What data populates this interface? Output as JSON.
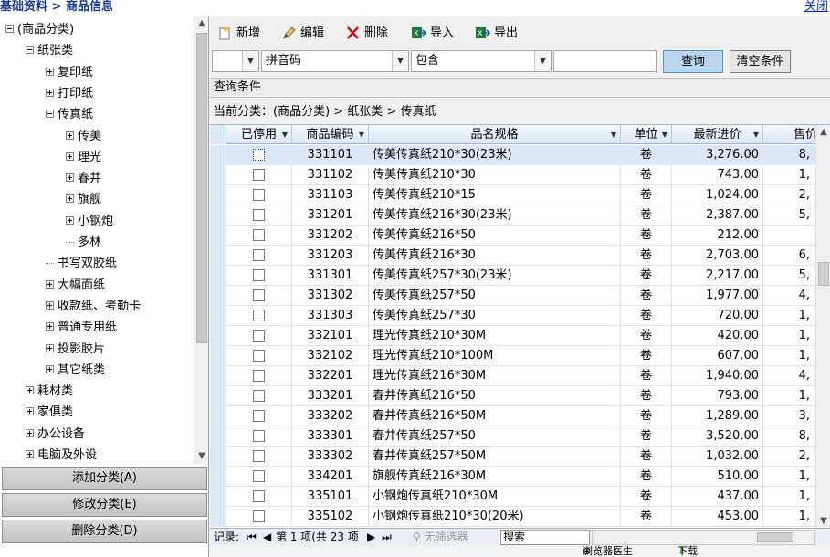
{
  "breadcrumb": "基础资料 > 商品信息",
  "close_link": "关闭",
  "tree": [
    {
      "label": "(商品分类)",
      "level": 0,
      "state": "minus"
    },
    {
      "label": "纸张类",
      "level": 1,
      "state": "minus"
    },
    {
      "label": "复印纸",
      "level": 2,
      "state": "plus"
    },
    {
      "label": "打印纸",
      "level": 2,
      "state": "plus"
    },
    {
      "label": "传真纸",
      "level": 2,
      "state": "minus"
    },
    {
      "label": "传美",
      "level": 3,
      "state": "plus"
    },
    {
      "label": "理光",
      "level": 3,
      "state": "plus"
    },
    {
      "label": "春井",
      "level": 3,
      "state": "plus"
    },
    {
      "label": "旗舰",
      "level": 3,
      "state": "plus"
    },
    {
      "label": "小钢炮",
      "level": 3,
      "state": "plus"
    },
    {
      "label": "多林",
      "level": 3,
      "state": "leaf"
    },
    {
      "label": "书写双胶纸",
      "level": 2,
      "state": "leaf"
    },
    {
      "label": "大幅面纸",
      "level": 2,
      "state": "plus"
    },
    {
      "label": "收款纸、考勤卡",
      "level": 2,
      "state": "plus"
    },
    {
      "label": "普通专用纸",
      "level": 2,
      "state": "plus"
    },
    {
      "label": "投影胶片",
      "level": 2,
      "state": "plus"
    },
    {
      "label": "其它纸类",
      "level": 2,
      "state": "plus"
    },
    {
      "label": "耗材类",
      "level": 1,
      "state": "plus"
    },
    {
      "label": "家俱类",
      "level": 1,
      "state": "plus"
    },
    {
      "label": "办公设备",
      "level": 1,
      "state": "plus"
    },
    {
      "label": "电脑及外设",
      "level": 1,
      "state": "plus"
    }
  ],
  "category_buttons": {
    "add": "添加分类(A)",
    "edit": "修改分类(E)",
    "delete": "删除分类(D)"
  },
  "toolbar": {
    "new": "新增",
    "edit": "编辑",
    "delete": "删除",
    "import": "导入",
    "export": "导出"
  },
  "filter": {
    "field1": "",
    "field2": "拼音码",
    "op": "包含",
    "value": "",
    "query_btn": "查询",
    "clear_btn": "清空条件"
  },
  "condition_label": "查询条件",
  "current_path": "当前分类：(商品分类) > 纸张类 > 传真纸",
  "grid": {
    "headers": {
      "disabled": "已停用",
      "code": "商品编码",
      "name": "品名规格",
      "unit": "单位",
      "last_price": "最新进价",
      "sale_price": "售价"
    },
    "rows": [
      {
        "code": "331101",
        "name": "传美传真纸210*30(23米)",
        "unit": "卷",
        "price": "3,276.00",
        "sale": "8,"
      },
      {
        "code": "331102",
        "name": "传美传真纸210*30",
        "unit": "卷",
        "price": "743.00",
        "sale": "1,"
      },
      {
        "code": "331103",
        "name": "传美传真纸210*15",
        "unit": "卷",
        "price": "1,024.00",
        "sale": "2,"
      },
      {
        "code": "331201",
        "name": "传美传真纸216*30(23米)",
        "unit": "卷",
        "price": "2,387.00",
        "sale": "5,"
      },
      {
        "code": "331202",
        "name": "传美传真纸216*50",
        "unit": "卷",
        "price": "212.00",
        "sale": ""
      },
      {
        "code": "331203",
        "name": "传美传真纸216*30",
        "unit": "卷",
        "price": "2,703.00",
        "sale": "6,"
      },
      {
        "code": "331301",
        "name": "传美传真纸257*30(23米)",
        "unit": "卷",
        "price": "2,217.00",
        "sale": "5,"
      },
      {
        "code": "331302",
        "name": "传美传真纸257*50",
        "unit": "卷",
        "price": "1,977.00",
        "sale": "4,"
      },
      {
        "code": "331303",
        "name": "传美传真纸257*30",
        "unit": "卷",
        "price": "720.00",
        "sale": "1,"
      },
      {
        "code": "332101",
        "name": "理光传真纸210*30M",
        "unit": "卷",
        "price": "420.00",
        "sale": "1,"
      },
      {
        "code": "332102",
        "name": "理光传真纸210*100M",
        "unit": "卷",
        "price": "607.00",
        "sale": "1,"
      },
      {
        "code": "332201",
        "name": "理光传真纸216*30M",
        "unit": "卷",
        "price": "1,940.00",
        "sale": "4,"
      },
      {
        "code": "333201",
        "name": "春井传真纸216*50",
        "unit": "卷",
        "price": "793.00",
        "sale": "1,"
      },
      {
        "code": "333202",
        "name": "春井传真纸216*50M",
        "unit": "卷",
        "price": "1,289.00",
        "sale": "3,"
      },
      {
        "code": "333301",
        "name": "春井传真纸257*50",
        "unit": "卷",
        "price": "3,520.00",
        "sale": "8,"
      },
      {
        "code": "333302",
        "name": "春井传真纸257*50M",
        "unit": "卷",
        "price": "1,032.00",
        "sale": "2,"
      },
      {
        "code": "334201",
        "name": "旗舰传真纸216*30M",
        "unit": "卷",
        "price": "510.00",
        "sale": "1,"
      },
      {
        "code": "335101",
        "name": "小钢炮传真纸210*30M",
        "unit": "卷",
        "price": "437.00",
        "sale": "1,"
      },
      {
        "code": "335102",
        "name": "小钢炮传真纸210*30(20米)",
        "unit": "卷",
        "price": "453.00",
        "sale": "1,"
      }
    ]
  },
  "navbar": {
    "records_label": "记录:",
    "first": "⏮",
    "prev": "◀",
    "position": "第 1 项(共 23 项",
    "next": "▶",
    "last": "⏭",
    "no_filter": "无筛选器",
    "search": "搜索"
  },
  "statusbar": {
    "doctor": "浏览器医生",
    "download": "下载"
  },
  "colors": {
    "accent": "#1a3a8f",
    "selected_row": "#dbe7f7",
    "query_button": "#b8d6ee"
  }
}
